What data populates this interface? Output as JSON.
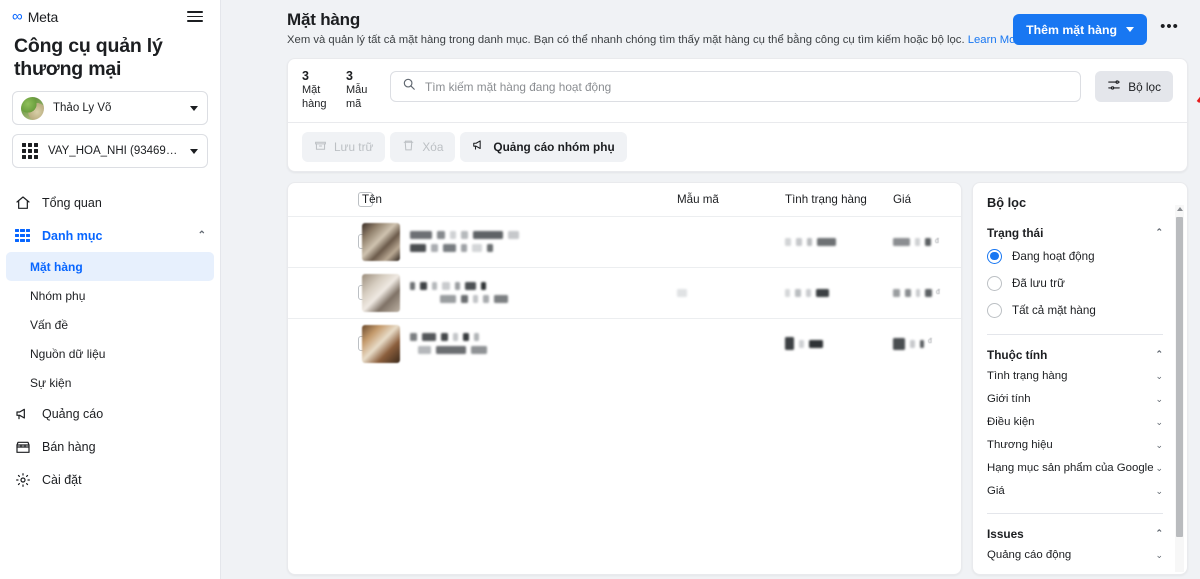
{
  "brand": {
    "logo_glyph": "∞",
    "name": "Meta"
  },
  "sidebar": {
    "app_title": "Công cụ quản lý thương mại",
    "user_selector": {
      "label": "Thảo Ly Võ"
    },
    "account_selector": {
      "label": "VAY_HOA_NHI (9346970305..."
    },
    "nav": [
      {
        "label": "Tổng quan",
        "icon": "home-icon"
      },
      {
        "label": "Danh mục",
        "icon": "grid-icon",
        "expanded": true
      },
      {
        "label": "Quảng cáo",
        "icon": "megaphone-icon"
      },
      {
        "label": "Bán hàng",
        "icon": "store-icon"
      },
      {
        "label": "Cài đặt",
        "icon": "gear-icon"
      }
    ],
    "catalog_children": [
      {
        "label": "Mặt hàng",
        "selected": true
      },
      {
        "label": "Nhóm phụ",
        "selected": false
      },
      {
        "label": "Vấn đề",
        "selected": false
      },
      {
        "label": "Nguồn dữ liệu",
        "selected": false
      },
      {
        "label": "Sự kiện",
        "selected": false
      }
    ]
  },
  "header": {
    "title": "Mặt hàng",
    "description": "Xem và quản lý tất cả mặt hàng trong danh mục. Bạn có thể nhanh chóng tìm thấy mặt hàng cụ thể bằng công cụ tìm kiếm hoặc bộ lọc.",
    "learn_more": "Learn More",
    "add_button": "Thêm mặt hàng",
    "more_button": "•••"
  },
  "toolbar": {
    "stats": [
      {
        "num": "3",
        "caption": "Mặt hàng"
      },
      {
        "num": "3",
        "caption": "Mẫu mã"
      }
    ],
    "search_placeholder": "Tìm kiếm mặt hàng đang hoạt động",
    "search_value": "",
    "filter_button": "Bộ lọc",
    "actions": [
      {
        "label": "Lưu trữ",
        "icon": "archive-icon",
        "disabled": true
      },
      {
        "label": "Xóa",
        "icon": "trash-icon",
        "disabled": true
      },
      {
        "label": "Quảng cáo nhóm phụ",
        "icon": "megaphone-icon",
        "disabled": false
      }
    ]
  },
  "table": {
    "columns": [
      "Tên",
      "Mẫu mã",
      "Tình trạng hàng",
      "Giá"
    ],
    "rows": [
      {
        "name_redacted": true,
        "sku_redacted": false,
        "stock_redacted": true,
        "price_redacted": true
      },
      {
        "name_redacted": true,
        "sku_redacted": true,
        "stock_redacted": true,
        "price_redacted": true
      },
      {
        "name_redacted": true,
        "sku_redacted": false,
        "stock_redacted": true,
        "price_redacted": true
      }
    ]
  },
  "filters": {
    "title": "Bộ lọc",
    "status_section": "Trạng thái",
    "status_options": [
      {
        "label": "Đang hoạt động",
        "selected": true
      },
      {
        "label": "Đã lưu trữ",
        "selected": false
      },
      {
        "label": "Tất cả mặt hàng",
        "selected": false
      }
    ],
    "attributes_section": "Thuộc tính",
    "attributes": [
      "Tình trạng hàng",
      "Giới tính",
      "Điều kiện",
      "Thương hiệu",
      "Hạng mục sản phẩm của Google",
      "Giá"
    ],
    "issues_section": "Issues",
    "issues": [
      "Quảng cáo động"
    ]
  },
  "annotation": {
    "highlight_color": "#e81c1c",
    "shape": "rectangle-and-arrow"
  },
  "colors": {
    "accent": "#1877f2",
    "brand": "#0866ff",
    "bg": "#f0f2f5",
    "annotation": "#e81c1c"
  }
}
